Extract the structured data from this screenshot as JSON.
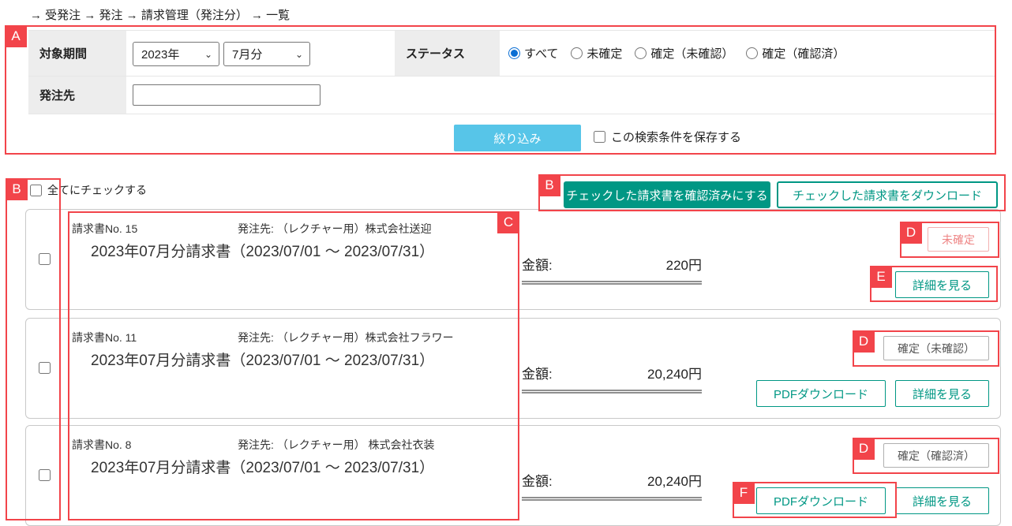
{
  "breadcrumb": "→ 受発注 → 発注 → 請求管理（発注分） → 一覧",
  "filter": {
    "period_label": "対象期間",
    "year_value": "2023年",
    "month_value": "7月分",
    "status_label": "ステータス",
    "status_options": [
      {
        "label": "すべて",
        "selected": true
      },
      {
        "label": "未確定",
        "selected": false
      },
      {
        "label": "確定（未確認）",
        "selected": false
      },
      {
        "label": "確定（確認済）",
        "selected": false
      }
    ],
    "client_label": "発注先",
    "client_value": "",
    "filter_button": "絞り込み",
    "save_condition_label": "この検索条件を保存する"
  },
  "list_header": {
    "check_all_label": "全てにチェックする",
    "confirm_checked_button": "チェックした請求書を確認済みにする",
    "download_checked_button": "チェックした請求書をダウンロード"
  },
  "invoices": [
    {
      "no": "請求書No. 15",
      "client_label": "発注先:",
      "client": "（レクチャー用）株式会社送迎",
      "title": "2023年07月分請求書（2023/07/01 ～ 2023/07/31）",
      "amount_label": "金額:",
      "amount": "220円",
      "status": "未確定",
      "detail_button": "詳細を見る"
    },
    {
      "no": "請求書No. 11",
      "client_label": "発注先:",
      "client": "（レクチャー用）株式会社フラワー",
      "title": "2023年07月分請求書（2023/07/01 ～ 2023/07/31）",
      "amount_label": "金額:",
      "amount": "20,240円",
      "status": "確定（未確認）",
      "pdf_button": "PDFダウンロード",
      "detail_button": "詳細を見る"
    },
    {
      "no": "請求書No. 8",
      "client_label": "発注先:",
      "client": "（レクチャー用） 株式会社衣装",
      "title": "2023年07月分請求書（2023/07/01 ～ 2023/07/31）",
      "amount_label": "金額:",
      "amount": "20,240円",
      "status": "確定（確認済）",
      "pdf_button": "PDFダウンロード",
      "detail_button": "詳細を見る"
    }
  ],
  "annotations": {
    "a": "A",
    "b": "B",
    "c": "C",
    "d": "D",
    "e": "E",
    "f": "F"
  },
  "colors": {
    "teal_accent": "#009784",
    "sky_blue_button": "#57c5e8",
    "annotation_red": "#f2444a",
    "status_pending_text": "#ee8585",
    "status_pending_border": "#f4b0b0",
    "status_confirmed_text": "#555555",
    "label_cell_background": "#ededed"
  }
}
